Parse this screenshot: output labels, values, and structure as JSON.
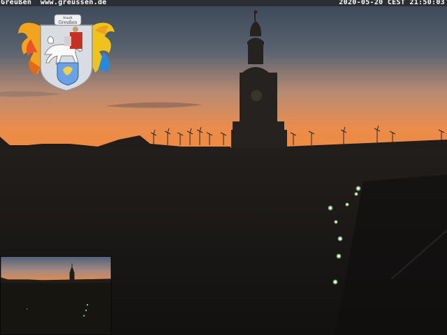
{
  "overlay": {
    "town_name": "Greußen",
    "website": "www.greussen.de",
    "timestamp": "2020-05-20 CEST 21:50:03"
  },
  "crest": {
    "scroll_text_line1": "Stadt",
    "scroll_text_line2": "Greußen"
  },
  "colors": {
    "sky_top": "#3d4a5c",
    "sky_horizon": "#e8894a",
    "ground": "#151412",
    "street_lights": "#d8ffd8"
  },
  "scene": {
    "subject": "dusk skyline with church tower and wind turbines",
    "inset": "smaller preview of the same view in the lower-left corner"
  }
}
